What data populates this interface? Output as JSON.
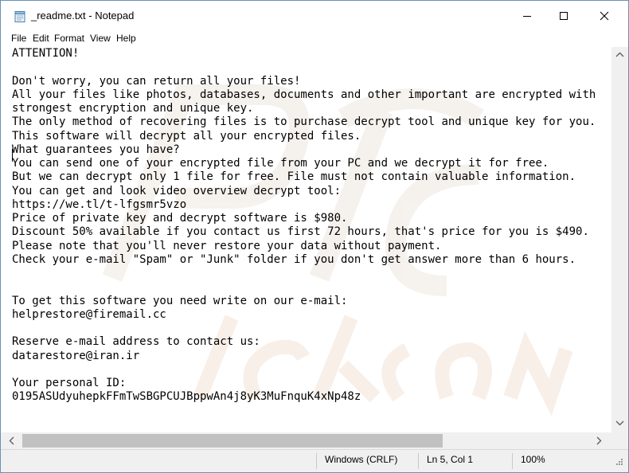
{
  "window": {
    "title": "_readme.txt - Notepad",
    "icon": "notepad-icon",
    "controls": [
      "minimize-icon",
      "maximize-icon",
      "close-icon"
    ]
  },
  "menu": {
    "items": [
      {
        "label": "File"
      },
      {
        "label": "Edit"
      },
      {
        "label": "Format"
      },
      {
        "label": "View"
      },
      {
        "label": "Help"
      }
    ]
  },
  "document": {
    "text": "ATTENTION!\n\nDon't worry, you can return all your files!\nAll your files like photos, databases, documents and other important are encrypted with\nstrongest encryption and unique key.\nThe only method of recovering files is to purchase decrypt tool and unique key for you.\nThis software will decrypt all your encrypted files.\nWhat guarantees you have?\nYou can send one of your encrypted file from your PC and we decrypt it for free.\nBut we can decrypt only 1 file for free. File must not contain valuable information.\nYou can get and look video overview decrypt tool:\nhttps://we.tl/t-lfgsmr5vzo\nPrice of private key and decrypt software is $980.\nDiscount 50% available if you contact us first 72 hours, that's price for you is $490.\nPlease note that you'll never restore your data without payment.\nCheck your e-mail \"Spam\" or \"Junk\" folder if you don't get answer more than 6 hours.\n\n\nTo get this software you need write on our e-mail:\nhelprestore@firemail.cc\n\nReserve e-mail address to contact us:\ndatarestore@iran.ir\n\nYour personal ID:\n0195ASUdyuhepkFFmTwSBGPCUJBppwAn4j8yK3MuFnquK4xNp48z"
  },
  "statusbar": {
    "encoding": "Windows (CRLF)",
    "position": "Ln 5, Col 1",
    "zoom": "100%"
  },
  "colors": {
    "window_border": "#6b8fb5",
    "chrome_bg": "#f0f0f0",
    "scroll_thumb": "#c1c1c1"
  }
}
